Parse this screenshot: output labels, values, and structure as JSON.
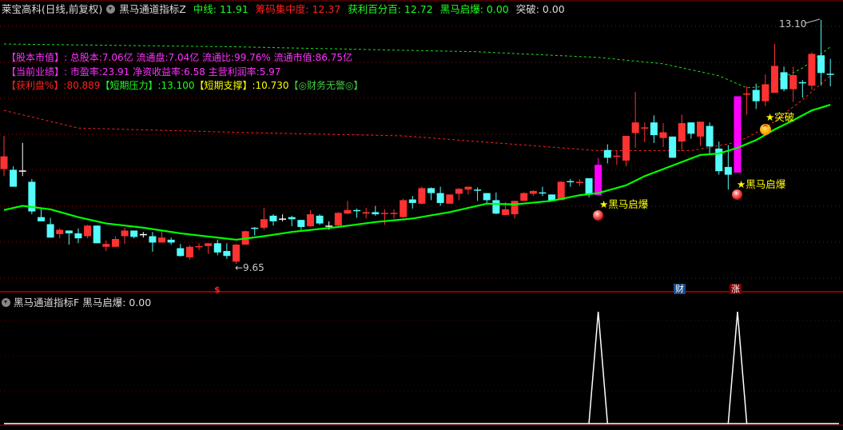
{
  "header": {
    "stock": "莱宝高科(日线,前复权)",
    "indicator": "黑马通道指标Z",
    "mid_line": "中线: 11.91",
    "chip_concentration": "筹码集中度: 12.37",
    "profit_pct": "获利百分百: 12.72",
    "dark_horse": "黑马启爆: 0.00",
    "breakout": "突破: 0.00"
  },
  "info": {
    "capital_label": "【股本市值】:",
    "capital_value": "总股本:7.06亿 流通盘:7.04亿 流通比:99.76% 流通市值:86.75亿",
    "perf_label": "【当前业绩】:",
    "perf_value": "市盈率:23.91 净资收益率:6.58 主营利润率:5.97",
    "profit_label": "【获利盘%】",
    "profit_value": ":80.889",
    "pressure_label": "【短期压力】",
    "pressure_value": ":13.100",
    "support_label": "【短期支撑】",
    "support_value": ":10.730",
    "finance": "【◎财务无警◎】"
  },
  "annotations": {
    "signal1": "黑马启爆",
    "signal2": "黑马启爆",
    "breakout": "突破",
    "high": "13.10",
    "low": "←9.65",
    "star": "★",
    "up": "^",
    "mark_dollar": "$",
    "mark_finance": "财",
    "mark_rise": "涨"
  },
  "sub": {
    "indicator": "黑马通道指标F",
    "value": "黑马启爆: 0.00"
  },
  "colors": {
    "up": "#ff3232",
    "down": "#54fcfc",
    "doji": "#ffffff",
    "signal": "#ff00ff",
    "mid": "#00ff00",
    "red_line": "#ff2020",
    "green_line": "#20e020",
    "grid": "#a00000"
  },
  "chart_data": {
    "type": "candlestick",
    "price_range": [
      9.65,
      13.1
    ],
    "candles_ochl_note": "each: [open, close, high, low]",
    "candles": [
      [
        10.99,
        11.17,
        11.46,
        10.89
      ],
      [
        10.98,
        10.74,
        11.03,
        10.74
      ],
      [
        10.97,
        10.97,
        11.36,
        10.89
      ],
      [
        10.81,
        10.39,
        10.85,
        10.35
      ],
      [
        10.31,
        10.25,
        10.44,
        10.25
      ],
      [
        10.21,
        10.02,
        10.3,
        10.02
      ],
      [
        10.07,
        10.13,
        10.15,
        10.01
      ],
      [
        10.12,
        10.08,
        10.12,
        9.92
      ],
      [
        10.08,
        10.01,
        10.15,
        9.94
      ],
      [
        10.04,
        10.19,
        10.2,
        10.01
      ],
      [
        10.19,
        9.94,
        10.19,
        9.94
      ],
      [
        9.89,
        9.93,
        9.98,
        9.83
      ],
      [
        9.89,
        10.0,
        10.04,
        9.89
      ],
      [
        10.04,
        10.12,
        10.16,
        9.93
      ],
      [
        10.12,
        10.03,
        10.12,
        10.01
      ],
      [
        10.07,
        10.07,
        10.1,
        10.02
      ],
      [
        10.04,
        9.95,
        10.1,
        9.82
      ],
      [
        9.95,
        10.02,
        10.11,
        9.95
      ],
      [
        9.99,
        9.95,
        10.02,
        9.92
      ],
      [
        9.87,
        9.76,
        9.93,
        9.75
      ],
      [
        9.74,
        9.89,
        9.91,
        9.71
      ],
      [
        9.89,
        9.9,
        9.94,
        9.84
      ],
      [
        9.9,
        9.94,
        9.94,
        9.79
      ],
      [
        9.94,
        9.81,
        9.99,
        9.77
      ],
      [
        9.83,
        9.76,
        9.94,
        9.72
      ],
      [
        9.68,
        9.92,
        9.93,
        9.65
      ],
      [
        9.92,
        10.11,
        10.12,
        9.92
      ],
      [
        10.16,
        10.15,
        10.17,
        10.05
      ],
      [
        10.16,
        10.28,
        10.44,
        10.13
      ],
      [
        10.33,
        10.25,
        10.35,
        10.19
      ],
      [
        10.29,
        10.29,
        10.35,
        10.25
      ],
      [
        10.31,
        10.28,
        10.33,
        10.18
      ],
      [
        10.27,
        10.17,
        10.27,
        10.13
      ],
      [
        10.18,
        10.35,
        10.41,
        10.17
      ],
      [
        10.33,
        10.22,
        10.35,
        10.2
      ],
      [
        10.19,
        10.19,
        10.25,
        10.13
      ],
      [
        10.19,
        10.37,
        10.38,
        10.17
      ],
      [
        10.36,
        10.41,
        10.54,
        10.35
      ],
      [
        10.41,
        10.4,
        10.43,
        10.3
      ],
      [
        10.36,
        10.38,
        10.44,
        10.29
      ],
      [
        10.38,
        10.35,
        10.47,
        10.33
      ],
      [
        10.36,
        10.37,
        10.42,
        10.2
      ],
      [
        10.36,
        10.37,
        10.42,
        10.29
      ],
      [
        10.31,
        10.55,
        10.57,
        10.3
      ],
      [
        10.56,
        10.51,
        10.61,
        10.43
      ],
      [
        10.5,
        10.72,
        10.74,
        10.49
      ],
      [
        10.72,
        10.65,
        10.73,
        10.55
      ],
      [
        10.65,
        10.51,
        10.74,
        10.47
      ],
      [
        10.5,
        10.63,
        10.63,
        10.5
      ],
      [
        10.64,
        10.71,
        10.72,
        10.55
      ],
      [
        10.7,
        10.74,
        10.74,
        10.63
      ],
      [
        10.7,
        10.69,
        10.73,
        10.54
      ],
      [
        10.65,
        10.55,
        10.65,
        10.51
      ],
      [
        10.55,
        10.36,
        10.66,
        10.35
      ],
      [
        10.34,
        10.42,
        10.52,
        10.34
      ],
      [
        10.35,
        10.54,
        10.54,
        10.29
      ],
      [
        10.54,
        10.65,
        10.66,
        10.54
      ],
      [
        10.64,
        10.68,
        10.69,
        10.61
      ],
      [
        10.66,
        10.65,
        10.74,
        10.61
      ],
      [
        10.63,
        10.54,
        10.63,
        10.54
      ],
      [
        10.55,
        10.81,
        10.82,
        10.55
      ],
      [
        10.82,
        10.81,
        10.85,
        10.74
      ],
      [
        10.8,
        10.81,
        10.85,
        10.75
      ],
      [
        10.86,
        10.63,
        10.86,
        10.59
      ],
      [
        10.62,
        11.05,
        11.15,
        10.62
      ],
      [
        11.26,
        11.15,
        11.34,
        11.07
      ],
      [
        11.17,
        11.18,
        11.25,
        11.05
      ],
      [
        11.11,
        11.46,
        11.46,
        11.03
      ],
      [
        11.5,
        11.65,
        12.08,
        11.29
      ],
      [
        11.57,
        11.58,
        11.65,
        11.37
      ],
      [
        11.65,
        11.47,
        11.75,
        11.36
      ],
      [
        11.43,
        11.51,
        11.64,
        11.3
      ],
      [
        11.45,
        11.15,
        11.45,
        11.15
      ],
      [
        11.38,
        11.64,
        11.76,
        11.25
      ],
      [
        11.65,
        11.49,
        11.65,
        11.42
      ],
      [
        11.45,
        11.66,
        11.66,
        11.32
      ],
      [
        11.6,
        11.31,
        11.65,
        11.21
      ],
      [
        11.28,
        10.96,
        11.38,
        10.91
      ],
      [
        11.02,
        10.91,
        11.33,
        10.7
      ],
      [
        10.94,
        12.02,
        12.02,
        10.94
      ],
      [
        12.05,
        12.06,
        12.16,
        11.76
      ],
      [
        12.11,
        11.95,
        12.2,
        11.84
      ],
      [
        11.95,
        12.19,
        12.33,
        11.88
      ],
      [
        12.07,
        12.45,
        12.76,
        12.07
      ],
      [
        12.36,
        12.12,
        12.44,
        12.09
      ],
      [
        12.12,
        12.32,
        12.44,
        11.94
      ],
      [
        12.22,
        12.21,
        12.25,
        12.0
      ],
      [
        12.17,
        12.62,
        12.64,
        12.11
      ],
      [
        12.6,
        12.35,
        13.1,
        12.17
      ],
      [
        12.34,
        12.33,
        12.55,
        12.16
      ]
    ],
    "signal_indices": [
      64,
      79
    ],
    "mid_line": [
      [
        0,
        10.41
      ],
      [
        2,
        10.47
      ],
      [
        5,
        10.42
      ],
      [
        8,
        10.31
      ],
      [
        11,
        10.22
      ],
      [
        15,
        10.16
      ],
      [
        19,
        10.08
      ],
      [
        23,
        10.02
      ],
      [
        25,
        9.99
      ],
      [
        28,
        10.04
      ],
      [
        31,
        10.1
      ],
      [
        36,
        10.17
      ],
      [
        40,
        10.24
      ],
      [
        44,
        10.29
      ],
      [
        48,
        10.38
      ],
      [
        52,
        10.5
      ],
      [
        55,
        10.49
      ],
      [
        59,
        10.54
      ],
      [
        62,
        10.62
      ],
      [
        64,
        10.65
      ],
      [
        67,
        10.76
      ],
      [
        69,
        10.89
      ],
      [
        72,
        11.04
      ],
      [
        75,
        11.19
      ],
      [
        77,
        11.21
      ],
      [
        79,
        11.29
      ],
      [
        81,
        11.4
      ],
      [
        83,
        11.55
      ],
      [
        85,
        11.68
      ],
      [
        87,
        11.82
      ],
      [
        89,
        11.9
      ]
    ],
    "chip_line": [
      [
        0,
        11.82
      ],
      [
        8,
        11.57
      ],
      [
        25,
        11.51
      ],
      [
        43,
        11.46
      ],
      [
        60,
        11.29
      ],
      [
        64,
        11.25
      ],
      [
        74,
        11.25
      ],
      [
        79,
        11.37
      ],
      [
        82,
        11.57
      ],
      [
        86,
        11.97
      ],
      [
        89,
        12.31
      ]
    ],
    "profit_line": [
      [
        0,
        12.76
      ],
      [
        25,
        12.72
      ],
      [
        51,
        12.65
      ],
      [
        64,
        12.57
      ],
      [
        71,
        12.48
      ],
      [
        77,
        12.31
      ],
      [
        80,
        12.14
      ],
      [
        82,
        12.16
      ],
      [
        86,
        12.42
      ],
      [
        89,
        12.72
      ]
    ],
    "sub_signal": {
      "range": [
        0,
        1
      ],
      "peaks": [
        64,
        79
      ]
    }
  }
}
